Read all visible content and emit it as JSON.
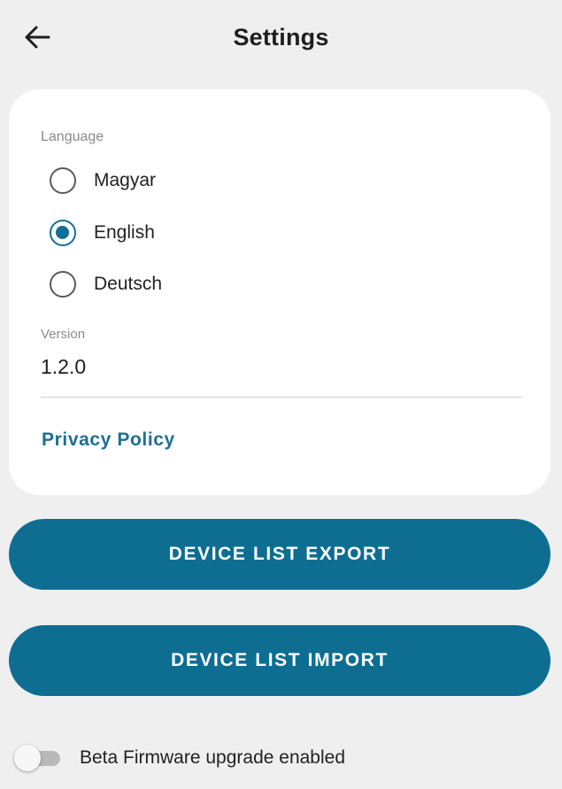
{
  "header": {
    "title": "Settings",
    "back_icon": "arrow-left-icon"
  },
  "card": {
    "language_label": "Language",
    "languages": [
      {
        "label": "Magyar",
        "selected": false
      },
      {
        "label": "English",
        "selected": true
      },
      {
        "label": "Deutsch",
        "selected": false
      }
    ],
    "version_label": "Version",
    "version_value": "1.2.0",
    "privacy_link": "Privacy Policy"
  },
  "buttons": {
    "export_label": "DEVICE LIST EXPORT",
    "import_label": "DEVICE LIST IMPORT"
  },
  "beta_toggle": {
    "label": "Beta Firmware upgrade enabled",
    "enabled": false
  },
  "colors": {
    "accent": "#0e6e92",
    "link": "#1d6f92",
    "background": "#efefef",
    "card": "#ffffff"
  }
}
